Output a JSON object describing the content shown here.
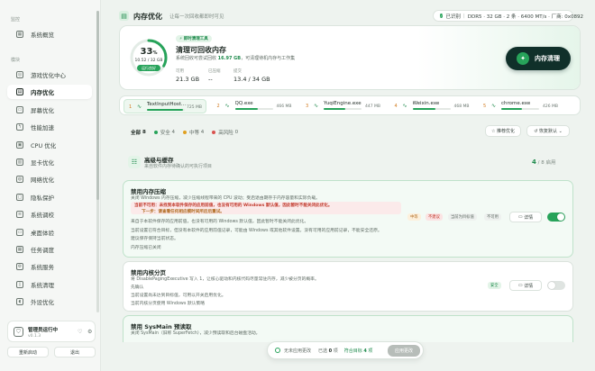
{
  "sidebar": {
    "section_monitor": "监控",
    "overview": "系统概览",
    "section_modules": "模块",
    "items": [
      {
        "label": "游戏优化中心",
        "icon": "gamepad-icon"
      },
      {
        "label": "内存优化",
        "icon": "memory-icon",
        "active": true
      },
      {
        "label": "屏幕优化",
        "icon": "monitor-icon"
      },
      {
        "label": "性能加速",
        "icon": "bolt-icon"
      },
      {
        "label": "CPU 优化",
        "icon": "cpu-icon"
      },
      {
        "label": "显卡优化",
        "icon": "gpu-icon"
      },
      {
        "label": "网络优化",
        "icon": "globe-icon"
      },
      {
        "label": "隐私保护",
        "icon": "lock-icon"
      },
      {
        "label": "系统调校",
        "icon": "sliders-icon"
      },
      {
        "label": "桌面体验",
        "icon": "desktop-icon"
      },
      {
        "label": "任务调度",
        "icon": "calendar-icon"
      },
      {
        "label": "系统服务",
        "icon": "gear-icon"
      },
      {
        "label": "系统清理",
        "icon": "trash-icon"
      },
      {
        "label": "外设优化",
        "icon": "mouse-icon"
      }
    ],
    "admin_title": "管理员运行中",
    "admin_version": "v0.1.3",
    "btn_restart": "重新启动",
    "btn_exit": "退出"
  },
  "header": {
    "title": "内存优化",
    "subtitle": "让每一次回收都即时可见",
    "hw_status": "已识别",
    "hw_info": "DDR5 · 32 GB · 2 条 · 6400 MT/s · 厂商: 0x0892"
  },
  "hero": {
    "percent": "33",
    "percent_unit": "%",
    "ring_mem": "10.52 / 32 GB",
    "ring_status": "运行良好",
    "ring_fraction": 0.33,
    "badge": "即时清理工具",
    "title": "清理可回收内存",
    "desc_prefix": "系统回收可尝试回收",
    "desc_value": "16.97 GB",
    "desc_suffix": "，可清理待机内存与工作集",
    "stats": [
      {
        "label": "可用",
        "value": "21.3 GB"
      },
      {
        "label": "已压缩",
        "value": "--"
      },
      {
        "label": "提交",
        "value": "13.4 / 34 GB"
      }
    ],
    "clean_button": "内存清理"
  },
  "processes": [
    {
      "rank": "1",
      "name": "TextInputHost...",
      "mb": "725 MB",
      "fraction": 0.95
    },
    {
      "rank": "2",
      "name": "QQ.exe",
      "mb": "466 MB",
      "fraction": 0.6
    },
    {
      "rank": "3",
      "name": "YuqiEngine.exe",
      "mb": "447 MB",
      "fraction": 0.58
    },
    {
      "rank": "4",
      "name": "Weixin.exe",
      "mb": "468 MB",
      "fraction": 0.6
    },
    {
      "rank": "5",
      "name": "chrome.exe",
      "mb": "426 MB",
      "fraction": 0.55
    }
  ],
  "filters": {
    "all": "全部",
    "all_count": "8",
    "safe": "安全",
    "safe_count": "4",
    "medium": "中等",
    "medium_count": "4",
    "high": "高风险",
    "high_count": "0",
    "recommend": "推荐优化",
    "restore": "恢复默认"
  },
  "category": {
    "title": "高级与缓存",
    "subtitle": "来自软件内存待确认的可执行项目",
    "count_value": "4",
    "count_suffix": "/ 8 启用"
  },
  "cards": [
    {
      "title": "禁用内存压缩",
      "desc": "关闭 Windows 内存压缩，减少压缩线程带来的 CPU 波动；受启退由期存于内存容量和实际负载。",
      "warn1": "当前不可用：未找到本软件保存的应用前值，也没有可用的 Windows 默认值，因此暂时不能关闭此优化。",
      "warn2": "下一步：请查看任何相应模时间所后后重试。",
      "line3": "来自于本软件保存的应用前值，也没有可用的 Windows 默认值，因此暂时不能关闭此优化。",
      "line4": "当前设置已符合目标，但没有本软件的应用前值记录，可能由 Windows 或其他软件设置。没有可用的应用前记录，不能安全还原。",
      "line5": "建议保存保持当前状态。",
      "line6": "内存压缩已关闭",
      "tags": [
        "中等",
        "不建议",
        "当前为目标值",
        "不可用"
      ],
      "detail": "详情"
    },
    {
      "title": "禁用内核分页",
      "desc": "将 DisablePagingExecutive 写入 1，让核心驱动和内核代码尽量常驻内存，减少被分页的概率。",
      "line3": "先确认",
      "line4": "当前设置尚未达到目标值，可用以开关启用优化。",
      "line5": "当前内核分页使用 Windows 默认策略",
      "tags": [
        "安全"
      ],
      "detail": "详情"
    },
    {
      "title": "禁用 SysMain 预读取",
      "desc": "关闭 SysMain（旧称 SuperFetch），减少预读取和后台磁盘活动。"
    }
  ],
  "bottom": {
    "status": "无未应用更改",
    "selected_label": "已选",
    "selected_count": "0",
    "selected_unit": "项",
    "match_label": "符合目标",
    "match_count": "4",
    "match_unit": "项",
    "apply": "应用更改"
  },
  "colors": {
    "accent": "#27a35a",
    "dark": "#10302a"
  }
}
